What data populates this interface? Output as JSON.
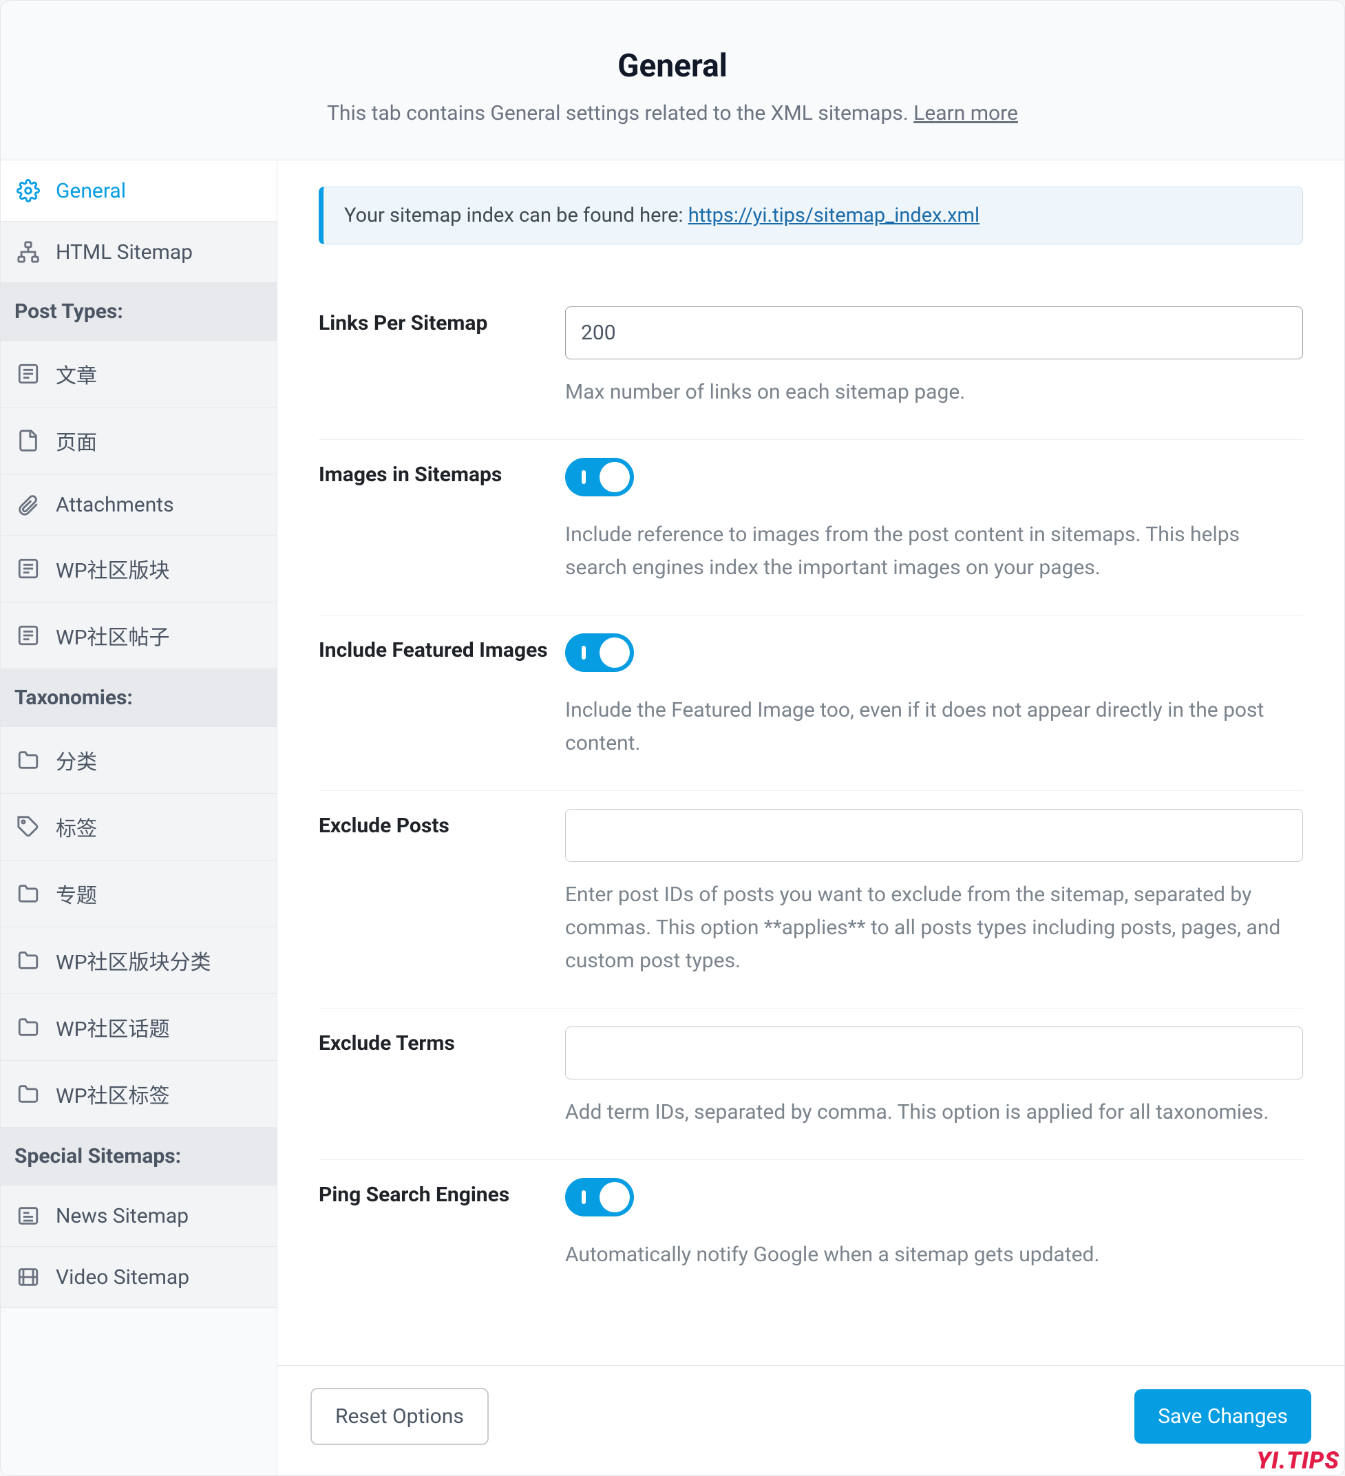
{
  "header": {
    "title": "General",
    "desc_prefix": "This tab contains General settings related to the XML sitemaps. ",
    "learn_more": "Learn more"
  },
  "sidebar": {
    "items_top": [
      {
        "label": "General",
        "icon": "gear",
        "active": true
      },
      {
        "label": "HTML Sitemap",
        "icon": "sitemap",
        "active": false
      }
    ],
    "group_post_types": "Post Types:",
    "post_types": [
      {
        "label": "文章",
        "icon": "post"
      },
      {
        "label": "页面",
        "icon": "page"
      },
      {
        "label": "Attachments",
        "icon": "attachment"
      },
      {
        "label": "WP社区版块",
        "icon": "post"
      },
      {
        "label": "WP社区帖子",
        "icon": "post"
      }
    ],
    "group_taxonomies": "Taxonomies:",
    "taxonomies": [
      {
        "label": "分类",
        "icon": "folder"
      },
      {
        "label": "标签",
        "icon": "tag"
      },
      {
        "label": "专题",
        "icon": "folder"
      },
      {
        "label": "WP社区版块分类",
        "icon": "folder"
      },
      {
        "label": "WP社区话题",
        "icon": "folder"
      },
      {
        "label": "WP社区标签",
        "icon": "folder"
      }
    ],
    "group_special": "Special Sitemaps:",
    "special": [
      {
        "label": "News Sitemap",
        "icon": "news"
      },
      {
        "label": "Video Sitemap",
        "icon": "video"
      }
    ]
  },
  "notice": {
    "prefix": "Your sitemap index can be found here: ",
    "url": "https://yi.tips/sitemap_index.xml"
  },
  "fields": {
    "links_per_sitemap": {
      "label": "Links Per Sitemap",
      "value": "200",
      "help": "Max number of links on each sitemap page."
    },
    "images_in_sitemaps": {
      "label": "Images in Sitemaps",
      "on": true,
      "help": "Include reference to images from the post content in sitemaps. This helps search engines index the important images on your pages."
    },
    "include_featured": {
      "label": "Include Featured Images",
      "on": true,
      "help": "Include the Featured Image too, even if it does not appear directly in the post content."
    },
    "exclude_posts": {
      "label": "Exclude Posts",
      "value": "",
      "help": "Enter post IDs of posts you want to exclude from the sitemap, separated by commas. This option **applies** to all posts types including posts, pages, and custom post types."
    },
    "exclude_terms": {
      "label": "Exclude Terms",
      "value": "",
      "help": "Add term IDs, separated by comma. This option is applied for all taxonomies."
    },
    "ping": {
      "label": "Ping Search Engines",
      "on": true,
      "help": "Automatically notify Google when a sitemap gets updated."
    }
  },
  "footer": {
    "reset": "Reset Options",
    "save": "Save Changes"
  },
  "watermark": "YI.TIPS"
}
